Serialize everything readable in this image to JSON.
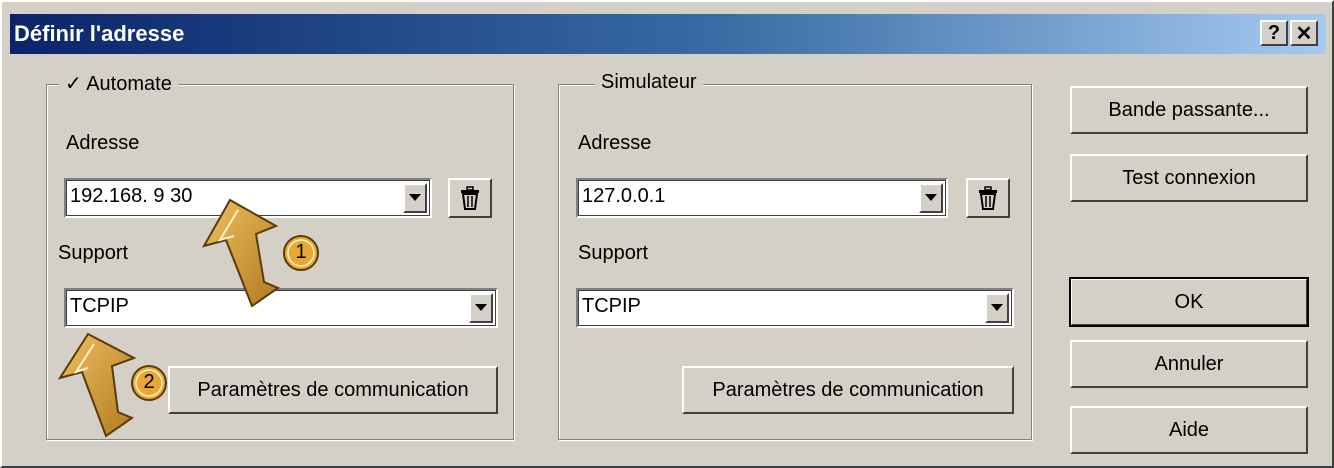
{
  "window": {
    "title": "Définir l'adresse",
    "help_glyph": "?",
    "close_glyph": "✕"
  },
  "plc_group": {
    "check_mark": "✓",
    "legend": "Automate",
    "address_label": "Adresse",
    "address_value": "192.168. 9 30",
    "support_label": "Support",
    "support_value": "TCPIP",
    "comm_params_label": "Paramètres de communication"
  },
  "sim_group": {
    "legend": "Simulateur",
    "address_label": "Adresse",
    "address_value": "127.0.0.1",
    "support_label": "Support",
    "support_value": "TCPIP",
    "comm_params_label": "Paramètres de communication"
  },
  "side_buttons": {
    "bandwidth": "Bande passante...",
    "test_connection": "Test connexion",
    "ok": "OK",
    "cancel": "Annuler",
    "help": "Aide"
  },
  "callouts": [
    {
      "number": "1"
    },
    {
      "number": "2"
    }
  ],
  "icons": {
    "dropdown": "chevron-down-icon",
    "delete": "trash-icon",
    "callout": "arrow-callout-icon"
  },
  "colors": {
    "dialog_bg": "#d4d0c8",
    "title_start": "#0a246a",
    "title_end": "#a6caf0",
    "arrow_fill": "#d9a441"
  }
}
